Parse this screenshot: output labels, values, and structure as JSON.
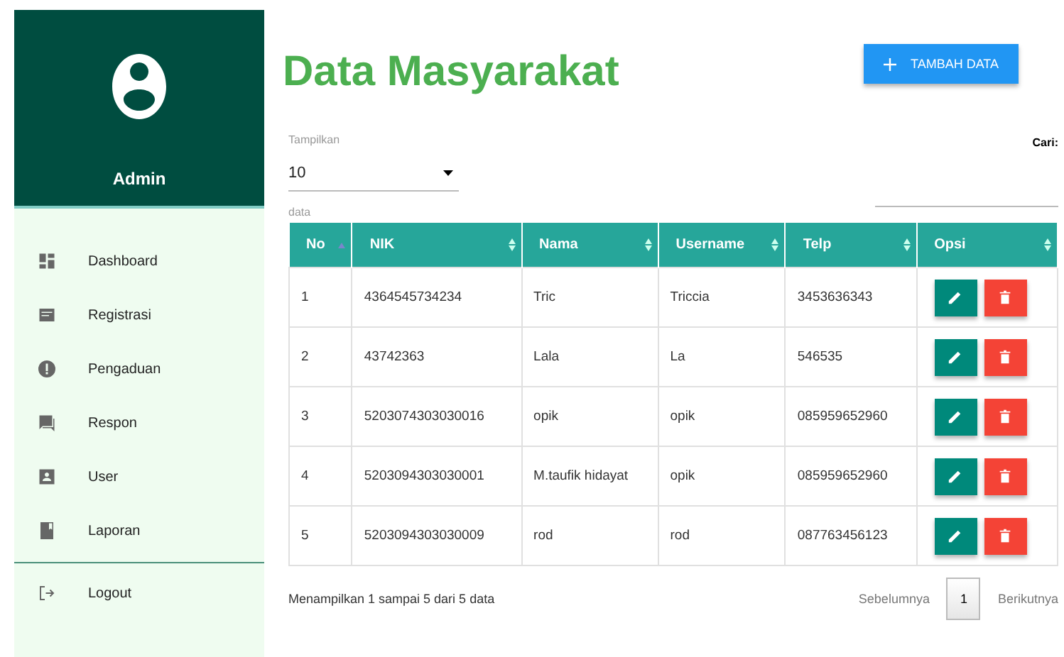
{
  "sidebar": {
    "user": {
      "name": "Admin"
    },
    "items": [
      {
        "label": "Dashboard"
      },
      {
        "label": "Registrasi"
      },
      {
        "label": "Pengaduan"
      },
      {
        "label": "Respon"
      },
      {
        "label": "User"
      },
      {
        "label": "Laporan"
      }
    ],
    "logout": {
      "label": "Logout"
    }
  },
  "page": {
    "title": "Data Masyarakat",
    "add_button": "TAMBAH DATA"
  },
  "length": {
    "label": "Tampilkan",
    "value": "10",
    "suffix": "data"
  },
  "search": {
    "label": "Cari:"
  },
  "table": {
    "columns": [
      {
        "label": "No",
        "sorted": true
      },
      {
        "label": "NIK",
        "sorted": false
      },
      {
        "label": "Nama",
        "sorted": false
      },
      {
        "label": "Username",
        "sorted": false
      },
      {
        "label": "Telp",
        "sorted": false
      },
      {
        "label": "Opsi",
        "sorted": false
      }
    ],
    "rows": [
      [
        "1",
        "4364545734234",
        "Tric",
        "Triccia",
        "3453636343"
      ],
      [
        "2",
        "43742363",
        "Lala",
        "La",
        "546535"
      ],
      [
        "3",
        "5203074303030016",
        "opik",
        "opik",
        "085959652960"
      ],
      [
        "4",
        "5203094303030001",
        "M.taufik hidayat",
        "opik",
        "085959652960"
      ],
      [
        "5",
        "5203094303030009",
        "rod",
        "rod",
        "087763456123"
      ]
    ]
  },
  "footer": {
    "info": "Menampilkan 1 sampai 5 dari 5 data",
    "previous": "Sebelumnya",
    "pages": [
      {
        "label": "1",
        "selected": true
      }
    ],
    "next": "Berikutnya"
  }
}
